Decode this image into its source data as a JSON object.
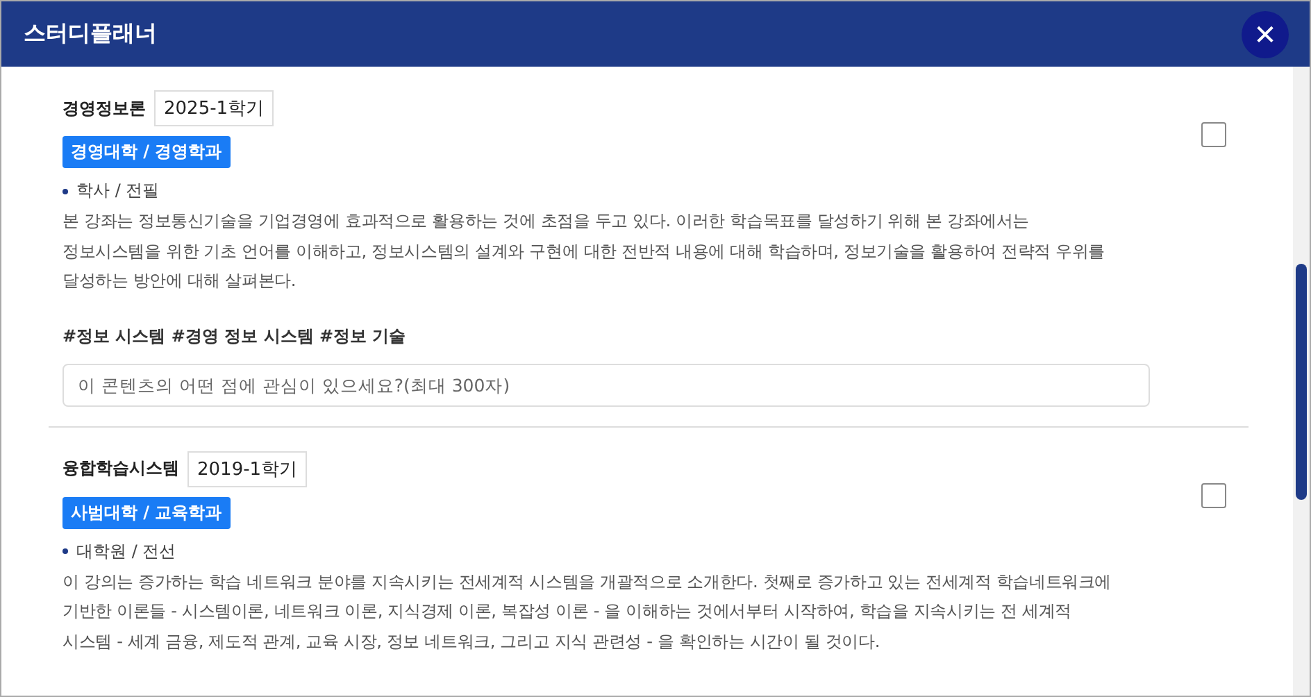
{
  "window": {
    "title": "스터디플래너",
    "close_label": "✕"
  },
  "courses": [
    {
      "title": "경영정보론",
      "semester": "2025-1학기",
      "department": "경영대학 / 경영학과",
      "meta": "학사 / 전필",
      "description": "본 강좌는 정보통신기술을 기업경영에 효과적으로 활용하는 것에 초점을 두고 있다. 이러한 학습목표를 달성하기 위해 본 강좌에서는\n정보시스템을 위한 기초 언어를 이해하고, 정보시스템의 설계와 구현에 대한 전반적 내용에 대해 학습하며, 정보기술을 활용하여 전략적 우위를\n달성하는 방안에 대해 살펴본다.",
      "tags": "#정보 시스템 #경영 정보 시스템 #정보 기술",
      "comment": {
        "placeholder": "이 콘텐츠의 어떤 점에 관심이 있으세요?(최대 300자)"
      },
      "checked": false
    },
    {
      "title": "융합학습시스템",
      "semester": "2019-1학기",
      "department": "사범대학 / 교육학과",
      "meta": "대학원 / 전선",
      "description": "이 강의는 증가하는 학습 네트워크 분야를 지속시키는 전세계적 시스템을 개괄적으로 소개한다. 첫째로 증가하고 있는 전세계적 학습네트워크에\n기반한 이론들 - 시스템이론, 네트워크 이론, 지식경제 이론, 복잡성 이론 - 을 이해하는 것에서부터 시작하여, 학습을 지속시키는 전 세계적\n시스템 - 세계 금융, 제도적 관계, 교육 시장, 정보 네트워크, 그리고 지식 관련성 - 을 확인하는 시간이 될 것이다.",
      "checked": false
    }
  ]
}
